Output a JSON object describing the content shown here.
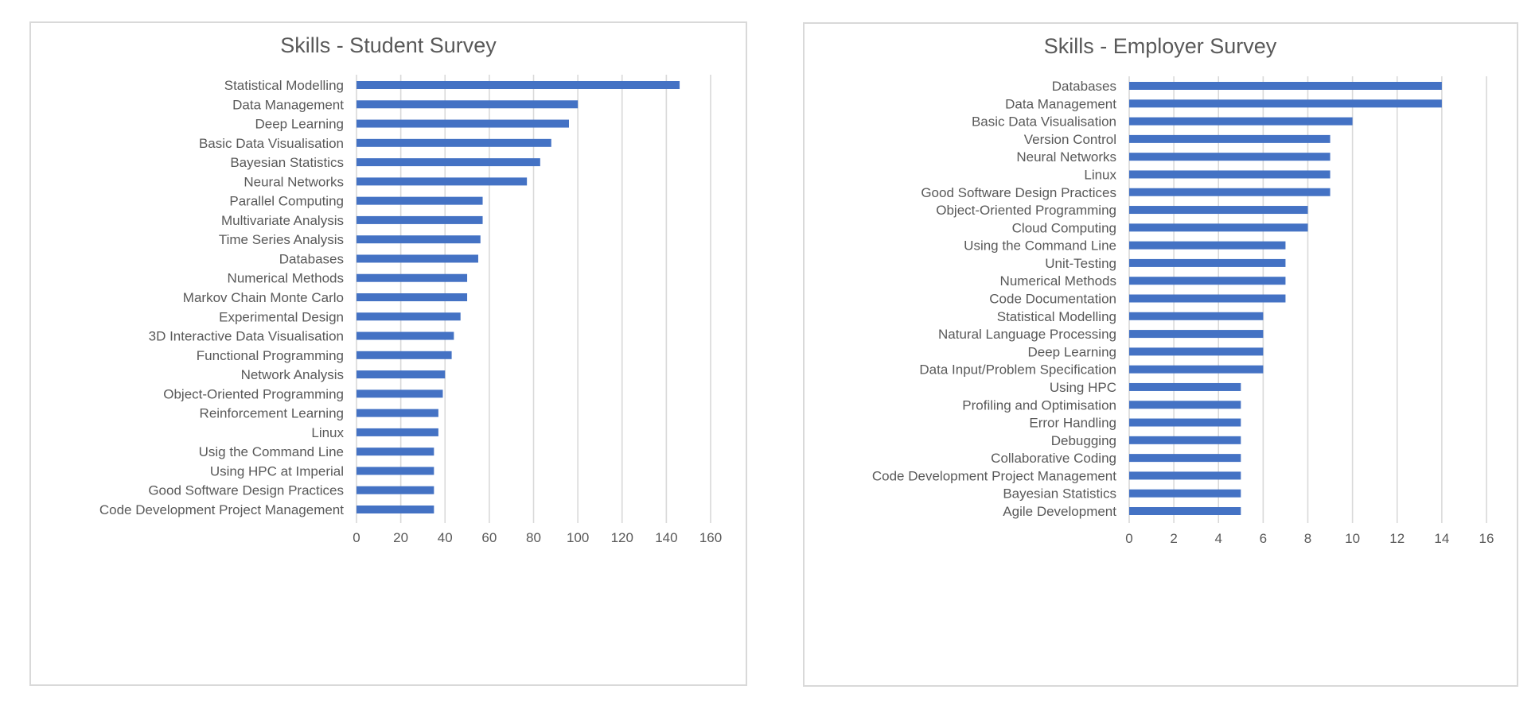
{
  "chart_data": [
    {
      "id": "student",
      "type": "bar",
      "orientation": "horizontal",
      "title": "Skills - Student Survey",
      "xlabel": "",
      "ylabel": "",
      "xlim": [
        0,
        160
      ],
      "xticks": [
        0,
        20,
        40,
        60,
        80,
        100,
        120,
        140,
        160
      ],
      "grid": true,
      "legend": "none",
      "bar_color": "#4472c4",
      "categories": [
        "Statistical Modelling",
        "Data Management",
        "Deep Learning",
        "Basic Data Visualisation",
        "Bayesian Statistics",
        "Neural Networks",
        "Parallel Computing",
        "Multivariate Analysis",
        "Time Series Analysis",
        "Databases",
        "Numerical Methods",
        "Markov Chain Monte Carlo",
        "Experimental Design",
        "3D Interactive Data Visualisation",
        "Functional Programming",
        "Network Analysis",
        "Object-Oriented Programming",
        "Reinforcement Learning",
        "Linux",
        "Usig the Command Line",
        "Using HPC at Imperial",
        "Good Software Design Practices",
        "Code Development Project Management"
      ],
      "values": [
        146,
        100,
        96,
        88,
        83,
        77,
        57,
        57,
        56,
        55,
        50,
        50,
        47,
        44,
        43,
        40,
        39,
        37,
        37,
        35,
        35,
        35,
        35
      ]
    },
    {
      "id": "employer",
      "type": "bar",
      "orientation": "horizontal",
      "title": "Skills - Employer Survey",
      "xlabel": "",
      "ylabel": "",
      "xlim": [
        0,
        16
      ],
      "xticks": [
        0,
        2,
        4,
        6,
        8,
        10,
        12,
        14,
        16
      ],
      "grid": true,
      "legend": "none",
      "bar_color": "#4472c4",
      "categories": [
        "Databases",
        "Data Management",
        "Basic Data Visualisation",
        "Version Control",
        "Neural Networks",
        "Linux",
        "Good Software Design Practices",
        "Object-Oriented Programming",
        "Cloud Computing",
        "Using the Command Line",
        "Unit-Testing",
        "Numerical Methods",
        "Code Documentation",
        "Statistical Modelling",
        "Natural Language Processing",
        "Deep Learning",
        "Data Input/Problem Specification",
        "Using HPC",
        "Profiling and Optimisation",
        "Error Handling",
        "Debugging",
        "Collaborative Coding",
        "Code Development Project Management",
        "Bayesian Statistics",
        "Agile Development"
      ],
      "values": [
        14,
        14,
        10,
        9,
        9,
        9,
        9,
        8,
        8,
        7,
        7,
        7,
        7,
        6,
        6,
        6,
        6,
        5,
        5,
        5,
        5,
        5,
        5,
        5,
        5
      ]
    }
  ]
}
